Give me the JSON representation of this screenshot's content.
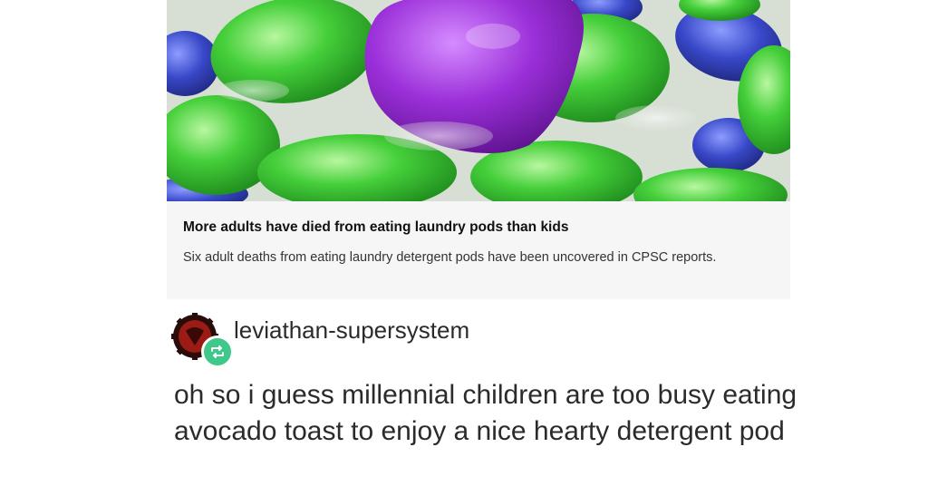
{
  "link_card": {
    "image_icon": "laundry-pods-photo",
    "title": "More adults have died from eating laundry pods than kids",
    "description": "Six adult deaths from eating laundry detergent pods have been uncovered in CPSC reports."
  },
  "post": {
    "avatar_icon": "gear-avatar-icon",
    "reblog_icon": "reblog-icon",
    "username": "leviathan-supersystem",
    "body": "oh so i guess millennial children are too busy eating avocado toast to enjoy a nice hearty detergent pod"
  },
  "colors": {
    "reblog_badge": "#3ec98a",
    "avatar_red": "#9b1c14",
    "pod_green": "#3fc43a",
    "pod_purple": "#9b2fd9",
    "pod_blue": "#3848c8"
  }
}
